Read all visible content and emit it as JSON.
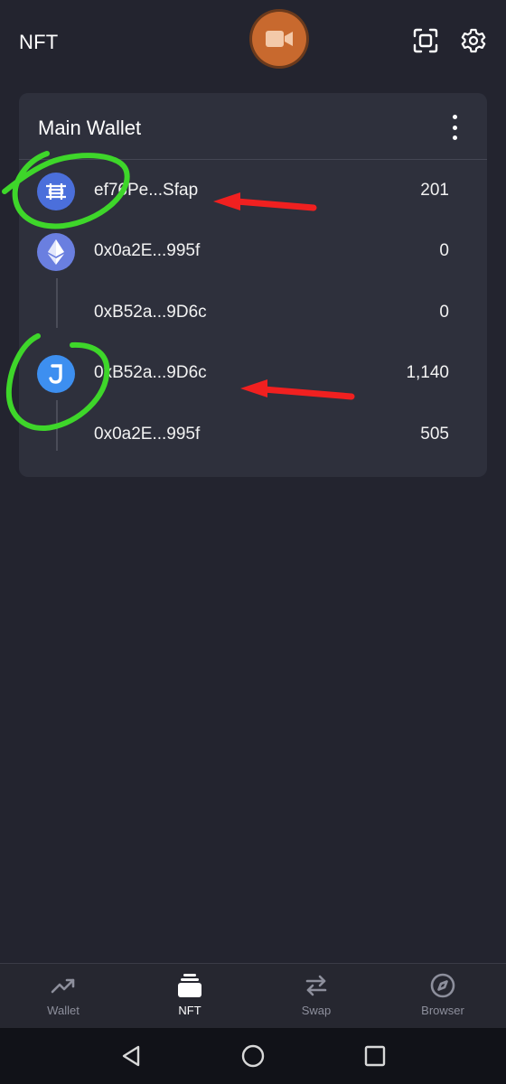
{
  "header": {
    "title": "NFT"
  },
  "wallet": {
    "name": "Main Wallet",
    "rows": [
      {
        "address": "ef76Pe...Sfap",
        "amount": "201",
        "icon": "layers-coin-icon"
      },
      {
        "address": "0x0a2E...995f",
        "amount": "0",
        "icon": "ethereum-icon"
      },
      {
        "address": "0xB52a...9D6c",
        "amount": "0",
        "icon": ""
      },
      {
        "address": "0xB52a...9D6c",
        "amount": "1,140",
        "icon": "j-coin-icon"
      },
      {
        "address": "0x0a2E...995f",
        "amount": "505",
        "icon": ""
      }
    ]
  },
  "nav": {
    "items": [
      {
        "label": "Wallet",
        "icon": "trending-up-icon"
      },
      {
        "label": "NFT",
        "icon": "stack-icon",
        "active": true
      },
      {
        "label": "Swap",
        "icon": "swap-arrows-icon"
      },
      {
        "label": "Browser",
        "icon": "compass-icon"
      }
    ]
  },
  "colors": {
    "background": "#23242f",
    "card": "#2e303c",
    "record_button": "#c8692e",
    "coin_blue": "#4b6fdb",
    "ethereum": "#6a7fe0",
    "j_coin": "#3d8ff0",
    "annotation_green": "#3ed62a",
    "annotation_red": "#f02020"
  }
}
